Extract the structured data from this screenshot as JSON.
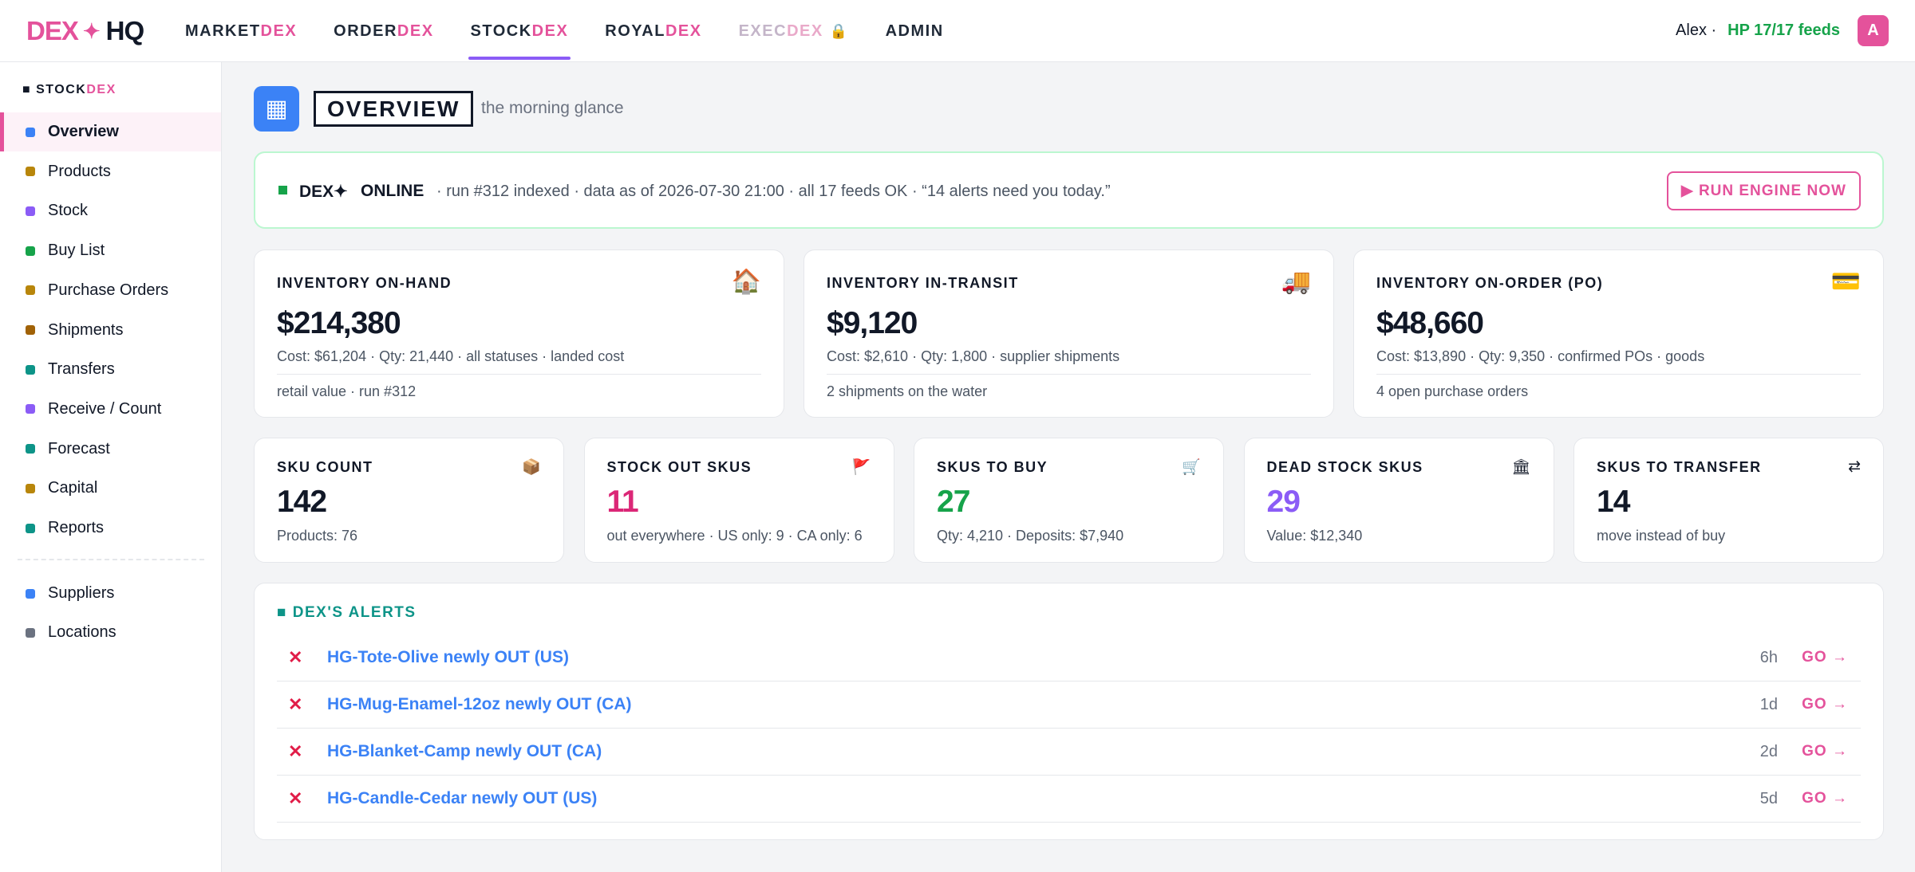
{
  "brand": {
    "left": "DEX",
    "spark": "✦",
    "right": "HQ"
  },
  "nav": [
    {
      "base": "MARKET",
      "dex": "DEX",
      "active": false,
      "disabled": false
    },
    {
      "base": "ORDER",
      "dex": "DEX",
      "active": false,
      "disabled": false
    },
    {
      "base": "STOCK",
      "dex": "DEX",
      "active": true,
      "disabled": false
    },
    {
      "base": "ROYAL",
      "dex": "DEX",
      "active": false,
      "disabled": false
    },
    {
      "base": "EXEC",
      "dex": "DEX",
      "active": false,
      "disabled": true,
      "lock": "🔒"
    },
    {
      "base": "ADMIN",
      "dex": "",
      "active": false,
      "disabled": false
    }
  ],
  "user": {
    "name": "Alex ·",
    "feeds": "HP 17/17 feeds",
    "avatar": "A"
  },
  "sidebar": {
    "title_square": "■",
    "title_base": "STOCK",
    "title_dex": "DEX",
    "items": [
      {
        "label": "Overview",
        "color": "#3b82f6",
        "active": true
      },
      {
        "label": "Products",
        "color": "#b8860b"
      },
      {
        "label": "Stock",
        "color": "#8b5cf6"
      },
      {
        "label": "Buy List",
        "color": "#16a34a"
      },
      {
        "label": "Purchase Orders",
        "color": "#b8860b"
      },
      {
        "label": "Shipments",
        "color": "#a16207"
      },
      {
        "label": "Transfers",
        "color": "#0d9488"
      },
      {
        "label": "Receive / Count",
        "color": "#8b5cf6"
      },
      {
        "label": "Forecast",
        "color": "#0d9488"
      },
      {
        "label": "Capital",
        "color": "#b8860b"
      },
      {
        "label": "Reports",
        "color": "#0d9488"
      }
    ],
    "secondary": [
      {
        "label": "Suppliers",
        "color": "#3b82f6"
      },
      {
        "label": "Locations",
        "color": "#6b7280"
      }
    ]
  },
  "page": {
    "icon": "▦",
    "title": "OVERVIEW",
    "subtitle": "the morning glance"
  },
  "status": {
    "name": "DEX✦",
    "state": "ONLINE",
    "desc": "· run #312 indexed · data as of 2026-07-30 21:00 · all 17 feeds OK · “14 alerts need you today.”",
    "button": "▶ RUN ENGINE NOW"
  },
  "inventory": [
    {
      "label": "INVENTORY ON-HAND",
      "icon": "🏠",
      "value": "$214,380",
      "sub": "Cost: $61,204 · Qty: 21,440 · all statuses · landed cost",
      "foot": "retail value · run #312"
    },
    {
      "label": "INVENTORY IN-TRANSIT",
      "icon": "🚚",
      "value": "$9,120",
      "sub": "Cost: $2,610 · Qty: 1,800 · supplier shipments",
      "foot": "2 shipments on the water"
    },
    {
      "label": "INVENTORY ON-ORDER (PO)",
      "icon": "💳",
      "value": "$48,660",
      "sub": "Cost: $13,890 · Qty: 9,350 · confirmed POs · goods",
      "foot": "4 open purchase orders"
    }
  ],
  "kpis": [
    {
      "label": "SKU COUNT",
      "icon": "📦",
      "value": "142",
      "sub": "Products: 76",
      "color": "#111827"
    },
    {
      "label": "STOCK OUT SKUS",
      "icon": "🚩",
      "value": "11",
      "sub": "out everywhere · US only: 9 · CA only: 6",
      "color": "#db2777"
    },
    {
      "label": "SKUS TO BUY",
      "icon": "🛒",
      "value": "27",
      "sub": "Qty: 4,210 · Deposits: $7,940",
      "color": "#16a34a"
    },
    {
      "label": "DEAD STOCK SKUS",
      "icon": "🏛",
      "value": "29",
      "sub": "Value: $12,340",
      "color": "#8b5cf6"
    },
    {
      "label": "SKUS TO TRANSFER",
      "icon": "⇄",
      "value": "14",
      "sub": "move instead of buy",
      "color": "#111827"
    }
  ],
  "alerts": {
    "title": "■ DEX'S ALERTS",
    "items": [
      {
        "mark": "✕",
        "text": "HG-Tote-Olive newly OUT (US)",
        "age": "6h",
        "action": "GO →"
      },
      {
        "mark": "✕",
        "text": "HG-Mug-Enamel-12oz newly OUT (CA)",
        "age": "1d",
        "action": "GO →"
      },
      {
        "mark": "✕",
        "text": "HG-Blanket-Camp newly OUT (CA)",
        "age": "2d",
        "action": "GO →"
      },
      {
        "mark": "✕",
        "text": "HG-Candle-Cedar newly OUT (US)",
        "age": "5d",
        "action": "GO →"
      }
    ]
  }
}
